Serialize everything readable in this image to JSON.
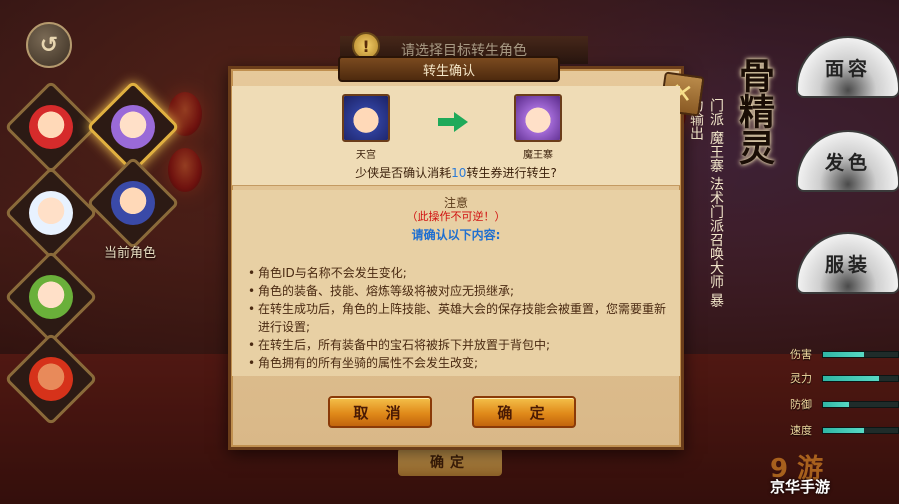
{
  "top_banner": {
    "hint": "请选择目标转生角色"
  },
  "dialog": {
    "title": "转生确认",
    "from_name": "天宫",
    "to_name": "魔王寨",
    "question_prefix": "少侠是否确认消耗",
    "question_num": "10",
    "question_suffix": "转生券进行转生?",
    "notice_title": "注意",
    "notice_warn": "（此操作不可逆！）",
    "notice_confirm": "请确认以下内容:",
    "rules": [
      "角色ID与名称不会发生变化;",
      "角色的装备、技能、熔炼等级将被对应无损继承;",
      "在转生成功后，角色的上阵技能、英雄大会的保存技能会被重置，您需要重新进行设置;",
      "在转生后，所有装备中的宝石将被拆下并放置于背包中;",
      "角色拥有的所有坐骑的属性不会发生改变;"
    ],
    "cancel_label": "取 消",
    "confirm_label": "确 定"
  },
  "left": {
    "current_label": "当前角色"
  },
  "right": {
    "title_art": "骨精灵",
    "school_line1": "门派",
    "school_name": "魔王寨",
    "school_line2": "法术门派召唤大师",
    "school_line3": "暴力输出",
    "fan_buttons": [
      "面容",
      "发色",
      "服装"
    ],
    "stats": [
      {
        "label": "伤害",
        "level": 0.55
      },
      {
        "label": "灵力",
        "level": 0.75
      },
      {
        "label": "防御",
        "level": 0.35
      },
      {
        "label": "速度",
        "level": 0.55
      }
    ]
  },
  "bottom_peek": {
    "label": "确定"
  },
  "watermark": {
    "text": "京华手游"
  },
  "colors": {
    "accent": "#e08a1a",
    "highlight_number": "#2b7bd8",
    "warn": "#d01010"
  }
}
